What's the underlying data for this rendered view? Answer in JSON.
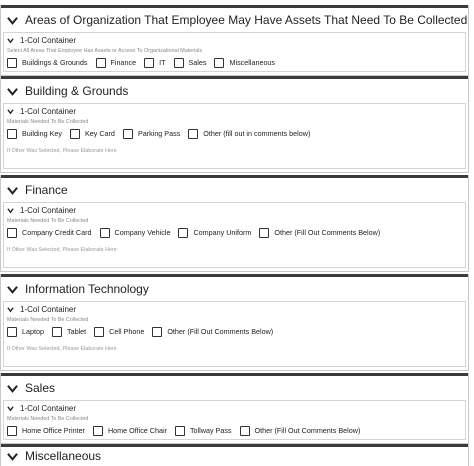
{
  "sections": [
    {
      "title": "Areas of Organization That Employee May Have Assets That Need To Be Collected",
      "container_title": "1-Col Container",
      "label": "Select All Areas That Employee Has Assets or Access To Organizational Materials",
      "options": [
        "Buildings & Grounds",
        "Finance",
        "IT",
        "Sales",
        "Miscellaneous"
      ],
      "elaborate": ""
    },
    {
      "title": "Building & Grounds",
      "container_title": "1-Col Container",
      "label": "Materials Needed To Be Collected",
      "options": [
        "Building Key",
        "Key Card",
        "Parking Pass",
        "Other (fill out in comments below)"
      ],
      "elaborate": "If Other Was Selected, Please Elaborate Here"
    },
    {
      "title": "Finance",
      "container_title": "1-Col Container",
      "label": "Materials Needed To Be Collected",
      "options": [
        "Company Credit Card",
        "Company Vehicle",
        "Company Uniform",
        "Other (Fill Out Comments Below)"
      ],
      "elaborate": "If Other Was Selected, Please Elaborate Here"
    },
    {
      "title": "Information Technology",
      "container_title": "1-Col Container",
      "label": "Materials Needed To Be Collected",
      "options": [
        "Laptop",
        "Tablet",
        "Cell Phone",
        "Other (Fill Out Comments Below)"
      ],
      "elaborate": "If Other Was Selected, Please Elaborate Here"
    },
    {
      "title": "Sales",
      "container_title": "1-Col Container",
      "label": "Materials Needed To Be Collected",
      "options": [
        "Home Office Printer",
        "Home Office Chair",
        "Tollway Pass",
        "Other (Fill Out Comments Below)"
      ],
      "elaborate": ""
    },
    {
      "title": "Miscellaneous",
      "container_title": "",
      "label": "",
      "options": [],
      "elaborate": ""
    }
  ]
}
